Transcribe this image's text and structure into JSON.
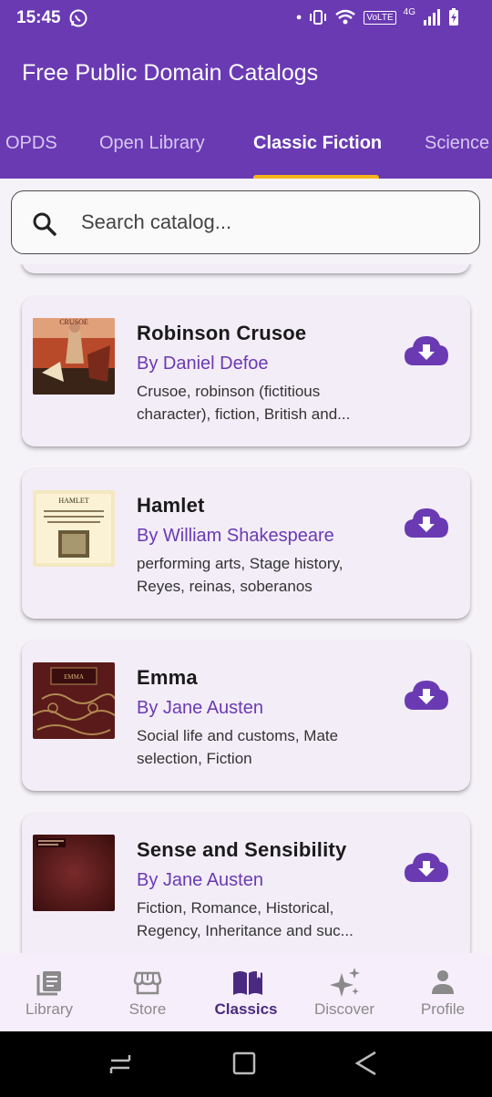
{
  "status": {
    "time": "15:45",
    "network": "4G",
    "volte": "VoLTE"
  },
  "app": {
    "title": "Free Public Domain Catalogs"
  },
  "tabs": [
    {
      "label": "OPDS"
    },
    {
      "label": "Open Library"
    },
    {
      "label": "Classic Fiction",
      "active": true
    },
    {
      "label": "Science"
    }
  ],
  "search": {
    "placeholder": "Search catalog..."
  },
  "books": [
    {
      "title": "Robinson Crusoe",
      "author": "By Daniel Defoe",
      "subjects": "Crusoe, robinson (fictitious character), fiction, British and...",
      "cover_label": "CRUSOE"
    },
    {
      "title": "Hamlet",
      "author": "By William Shakespeare",
      "subjects": "performing arts, Stage history, Reyes, reinas, soberanos",
      "cover_label": "HAMLET"
    },
    {
      "title": "Emma",
      "author": "By Jane Austen",
      "subjects": "Social life and customs, Mate selection, Fiction",
      "cover_label": "EMMA"
    },
    {
      "title": "Sense and Sensibility",
      "author": "By Jane Austen",
      "subjects": "Fiction, Romance, Historical, Regency, Inheritance and suc...",
      "cover_label": ""
    }
  ],
  "bottom_nav": [
    {
      "label": "Library",
      "icon": "library-icon"
    },
    {
      "label": "Store",
      "icon": "store-icon"
    },
    {
      "label": "Classics",
      "icon": "book-open-icon",
      "active": true
    },
    {
      "label": "Discover",
      "icon": "sparkle-icon"
    },
    {
      "label": "Profile",
      "icon": "person-icon"
    }
  ],
  "colors": {
    "primary": "#6a3ab3",
    "accent": "#f5b51a",
    "card": "#f3edf7"
  }
}
